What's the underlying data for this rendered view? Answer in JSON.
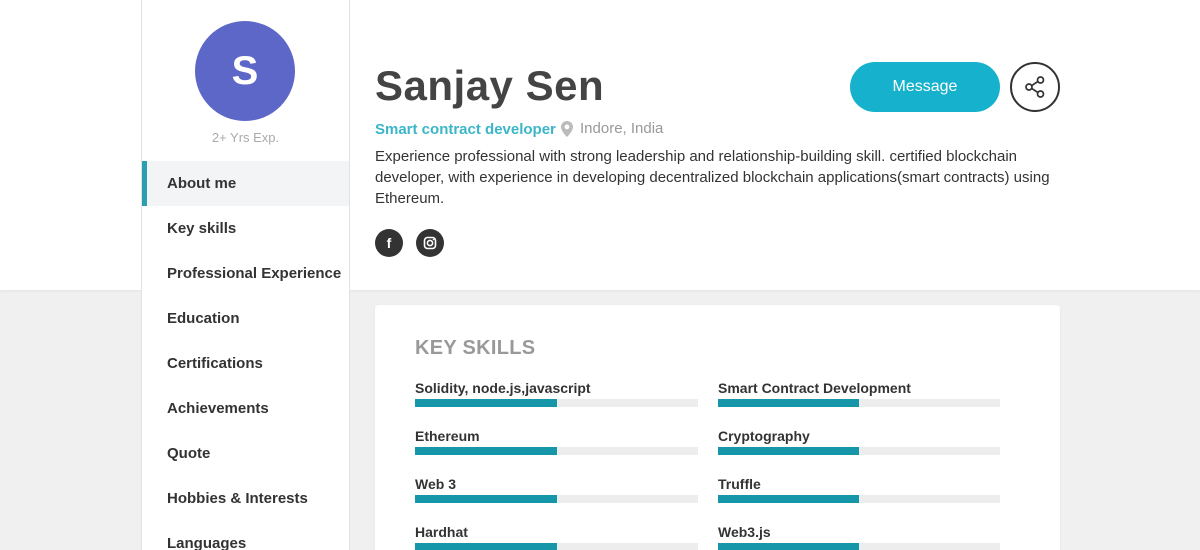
{
  "sidebar": {
    "avatar_initial": "S",
    "experience": "2+ Yrs Exp.",
    "active_index": 0,
    "items": [
      {
        "label": "About me"
      },
      {
        "label": "Key skills"
      },
      {
        "label": "Professional Experience"
      },
      {
        "label": "Education"
      },
      {
        "label": "Certifications"
      },
      {
        "label": "Achievements"
      },
      {
        "label": "Quote"
      },
      {
        "label": "Hobbies & Interests"
      },
      {
        "label": "Languages"
      }
    ]
  },
  "profile": {
    "name": "Sanjay Sen",
    "role": "Smart contract developer",
    "location": "Indore, India",
    "bio": "Experience professional with strong leadership and relationship-building skill. certified blockchain developer, with experience in developing decentralized blockchain applications(smart contracts) using Ethereum.",
    "social": [
      {
        "icon": "facebook-icon",
        "glyph": "f"
      },
      {
        "icon": "instagram-icon",
        "glyph": ""
      }
    ]
  },
  "actions": {
    "message_label": "Message",
    "share_icon": "share-icon"
  },
  "skills_section": {
    "title": "KEY SKILLS",
    "items": [
      {
        "name": "Solidity, node.js,javascript",
        "level": 0.5
      },
      {
        "name": "Smart Contract Development",
        "level": 0.5
      },
      {
        "name": "Ethereum",
        "level": 0.5
      },
      {
        "name": "Cryptography",
        "level": 0.5
      },
      {
        "name": "Web 3",
        "level": 0.5
      },
      {
        "name": "Truffle",
        "level": 0.5
      },
      {
        "name": "Hardhat",
        "level": 0.5
      },
      {
        "name": "Web3.js",
        "level": 0.5
      }
    ]
  },
  "colors": {
    "accent": "#16b2cd",
    "avatar_bg": "#5c67c7",
    "skill_fill": "#1696a9",
    "role_text": "#3bb6c9"
  }
}
